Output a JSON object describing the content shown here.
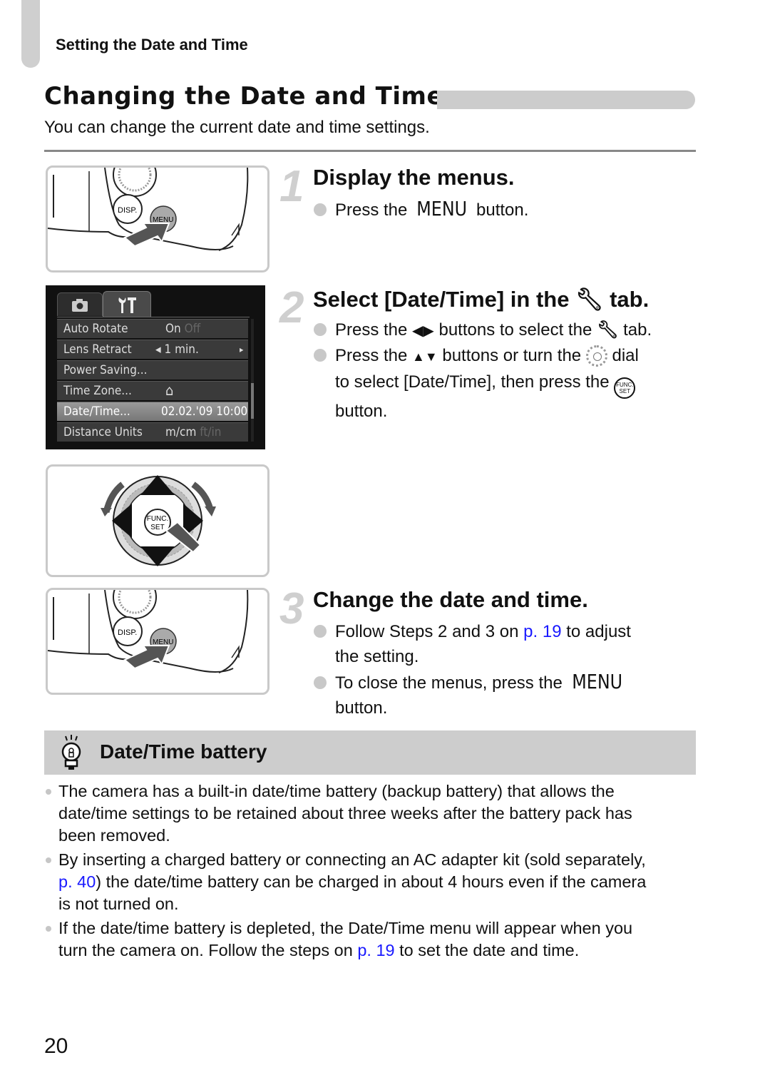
{
  "header": {
    "running_head": "Setting the Date and Time"
  },
  "section": {
    "title": "Changing the Date and Time",
    "intro": "You can change the current date and time settings."
  },
  "steps": [
    {
      "number": "1",
      "title": "Display the menus.",
      "bullets": [
        {
          "pre": "Press the ",
          "menu": "MENU",
          "post": " button."
        }
      ]
    },
    {
      "number": "2",
      "title_pre": "Select [Date/Time] in the ",
      "title_post": " tab.",
      "bullets": [
        {
          "pre": "Press the ",
          "mid": " buttons to select the ",
          "post": " tab."
        },
        {
          "pre": "Press the ",
          "mid": " buttons or turn the ",
          "post": " dial",
          "line2_pre": "to select [Date/Time], then press the ",
          "line3": "button."
        }
      ]
    },
    {
      "number": "3",
      "title": "Change the date and time.",
      "bullets": [
        {
          "pre": "Follow Steps 2 and 3 on ",
          "link": "p. 19",
          "post": " to adjust",
          "line2": "the setting."
        },
        {
          "pre": "To close the menus, press the ",
          "menu": "MENU",
          "line2": "button."
        }
      ]
    }
  ],
  "camera_illustration": {
    "disp_label": "DISP.",
    "menu_label": "MENU",
    "func_label": "FUNC.",
    "set_label": "SET"
  },
  "menu_screen": {
    "tabs": [
      {
        "name": "camera-tab",
        "icon": "camera-icon"
      },
      {
        "name": "settings-tab",
        "icon": "wrench-hammer-icon",
        "active": true
      }
    ],
    "rows": [
      {
        "label": "Auto Rotate",
        "value": "On",
        "value_dim": "Off"
      },
      {
        "label": "Lens Retract",
        "value": "◂ 1 min.",
        "arrow_right": "▸"
      },
      {
        "label": "Power Saving...",
        "value": ""
      },
      {
        "label": "Time Zone...",
        "value": "⌂"
      },
      {
        "label": "Date/Time...",
        "value": "02.02.'09 10:00",
        "selected": true
      },
      {
        "label": "Distance Units",
        "value": "m/cm",
        "value_dim": "ft/in"
      }
    ]
  },
  "tip": {
    "icon": "lightbulb-icon",
    "title": "Date/Time battery",
    "notes": [
      {
        "lines": [
          "The camera has a built-in date/time battery (backup battery) that allows the",
          "date/time settings to be retained about three weeks after the battery pack has",
          "been removed."
        ]
      },
      {
        "line1": "By inserting a charged battery or connecting an AC adapter kit (sold separately,",
        "link": "p. 40",
        "line2_post": ") the date/time battery can be charged in about 4 hours even if the camera",
        "line3": "is not turned on."
      },
      {
        "line1": "If the date/time battery is depleted, the Date/Time menu will appear when you",
        "line2_pre": "turn the camera on. Follow the steps on ",
        "link": "p. 19",
        "line2_post": " to set the date and time."
      }
    ]
  },
  "footer": {
    "page_number": "20"
  }
}
